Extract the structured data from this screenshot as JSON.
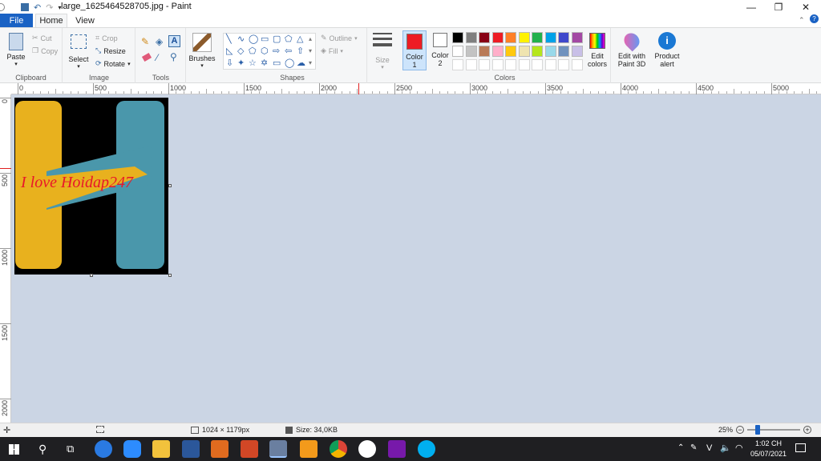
{
  "window": {
    "title": "large_1625464528705.jpg - Paint",
    "minimize": "—",
    "restore": "❐",
    "close": "✕"
  },
  "tabs": {
    "file": "File",
    "home": "Home",
    "view": "View"
  },
  "clipboard": {
    "paste": "Paste",
    "cut": "Cut",
    "copy": "Copy",
    "label": "Clipboard"
  },
  "image_group": {
    "select": "Select",
    "crop": "Crop",
    "resize": "Resize",
    "rotate": "Rotate",
    "label": "Image"
  },
  "tools": {
    "label": "Tools"
  },
  "brushes": {
    "label": "Brushes"
  },
  "shapes": {
    "outline": "Outline",
    "fill": "Fill",
    "label": "Shapes"
  },
  "size": {
    "label": "Size"
  },
  "colors": {
    "color1_label": "Color 1",
    "color1_value": "#ed1c24",
    "color2_label": "Color 2",
    "color2_value": "#ffffff",
    "edit_colors": "Edit colors",
    "label": "Colors",
    "palette_row1": [
      "#000000",
      "#7f7f7f",
      "#880015",
      "#ed1c24",
      "#ff7f27",
      "#fff200",
      "#22b14c",
      "#00a2e8",
      "#3f48cc",
      "#a349a4"
    ],
    "palette_row2": [
      "#ffffff",
      "#c3c3c3",
      "#b97a57",
      "#ffaec9",
      "#ffc90e",
      "#efe4b0",
      "#b5e61d",
      "#99d9ea",
      "#7092be",
      "#c8bfe7"
    ]
  },
  "edit_paint3d": "Edit with Paint 3D",
  "product_alert": "Product alert",
  "ruler_h": [
    "0",
    "500",
    "1000",
    "1500",
    "2000",
    "2500",
    "3000",
    "3500",
    "4000",
    "4500",
    "5000"
  ],
  "ruler_v": [
    "0",
    "500",
    "1000",
    "1500",
    "2000"
  ],
  "image_text": "I love Hoidap247",
  "status": {
    "dimensions": "1024 × 1179px",
    "size": "Size: 34,0KB",
    "zoom": "25%"
  },
  "tray": {
    "time": "1:02 CH",
    "date": "05/07/2021",
    "lang": "V"
  }
}
